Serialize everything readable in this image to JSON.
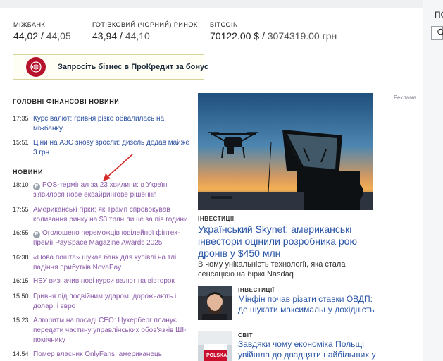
{
  "rates": [
    {
      "label": "МІЖБАНК",
      "buy": "44,02",
      "sep": " / ",
      "sell": "44,05"
    },
    {
      "label": "ГОТІВКОВИЙ (ЧОРНИЙ) РИНОК",
      "buy": "43,94",
      "sep": " / ",
      "sell": "44,10"
    },
    {
      "label": "BITCOIN",
      "buy": "70122.00 $",
      "sep": " / ",
      "sell": "3074319.00 грн"
    }
  ],
  "right_panel": {
    "text": "ПО"
  },
  "banner": {
    "text": "Запросіть бізнес в ПроКредит за бонус"
  },
  "sections": {
    "main_news": "ГОЛОВНІ ФІНАНСОВІ НОВИНИ",
    "news": "НОВИНИ"
  },
  "main_news": [
    {
      "time": "17:35",
      "title": "Курс валют: гривня різко обвалилась на міжбанку"
    },
    {
      "time": "15:51",
      "title": "Ціни на АЗС знову зросли: дизель додав майже 3 грн"
    }
  ],
  "news": [
    {
      "time": "18:10",
      "badge": "P",
      "title": "POS-термінал за 23 хвилини: в Україні з'явилося нове еквайрингове рішення"
    },
    {
      "time": "17:55",
      "badge": "",
      "title": "Американські гірки: як Трамп спровокував коливання ринку на $3 трлн лише за пів години"
    },
    {
      "time": "16:55",
      "badge": "P",
      "title": "Оголошено переможців ювілейної фінтех-премії PaySpace Magazine Awards 2025"
    },
    {
      "time": "16:38",
      "badge": "",
      "title": "«Нова пошта» шукає банк для купівлі на тлі падіння прибутків NovaPay"
    },
    {
      "time": "16:15",
      "badge": "",
      "title": "НБУ визначив нові курси валют на вівторок"
    },
    {
      "time": "15:50",
      "badge": "",
      "title": "Гривня під подвійним ударом: дорожчають і долар, і євро"
    },
    {
      "time": "15:23",
      "badge": "",
      "title": "Алгоритм на посаді CEO: Цукерберг планує передати частину управлінських обов'язків ШІ-помічнику"
    },
    {
      "time": "14:54",
      "badge": "",
      "title": "Помер власник OnlyFans, американець"
    }
  ],
  "ad_label": "Реклама",
  "featured": {
    "category": "ІНВЕСТИЦІЇ",
    "title": "Український Skynet: американські інвестори оцінили розробника рою дронів у $450 млн",
    "lead": "В чому унікальність технології, яка стала сенсацією на біржі Nasdaq"
  },
  "small_articles": [
    {
      "category": "ІНВЕСТИЦІЇ",
      "title": "Мінфін почав різати ставки ОВДП: де шукати максимальну дохідність"
    },
    {
      "category": "СВІТ",
      "title": "Завдяки чому економіка Польщі увійшла до двадцяти найбільших у світі"
    }
  ],
  "thumb_text": "POLSKA",
  "colors": {
    "link": "#2a55a6",
    "visited": "#8a5aa8",
    "brand": "#b5122b",
    "arrow": "#d42a2a"
  }
}
